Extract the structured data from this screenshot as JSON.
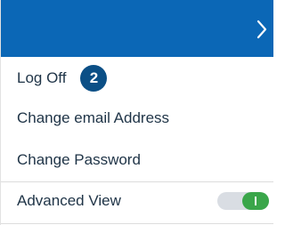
{
  "header": {
    "chevron_icon": "chevron-right-icon",
    "background_color": "#0b67b6"
  },
  "menu": {
    "log_off_label": "Log Off",
    "log_off_badge": "2",
    "change_email_label": "Change email Address",
    "change_password_label": "Change Password",
    "advanced_view_label": "Advanced View",
    "advanced_view_enabled": true
  },
  "colors": {
    "text": "#1f3447",
    "badge": "#0b4f86",
    "toggle_on": "#3aa64a",
    "toggle_track": "#d9dde3"
  }
}
